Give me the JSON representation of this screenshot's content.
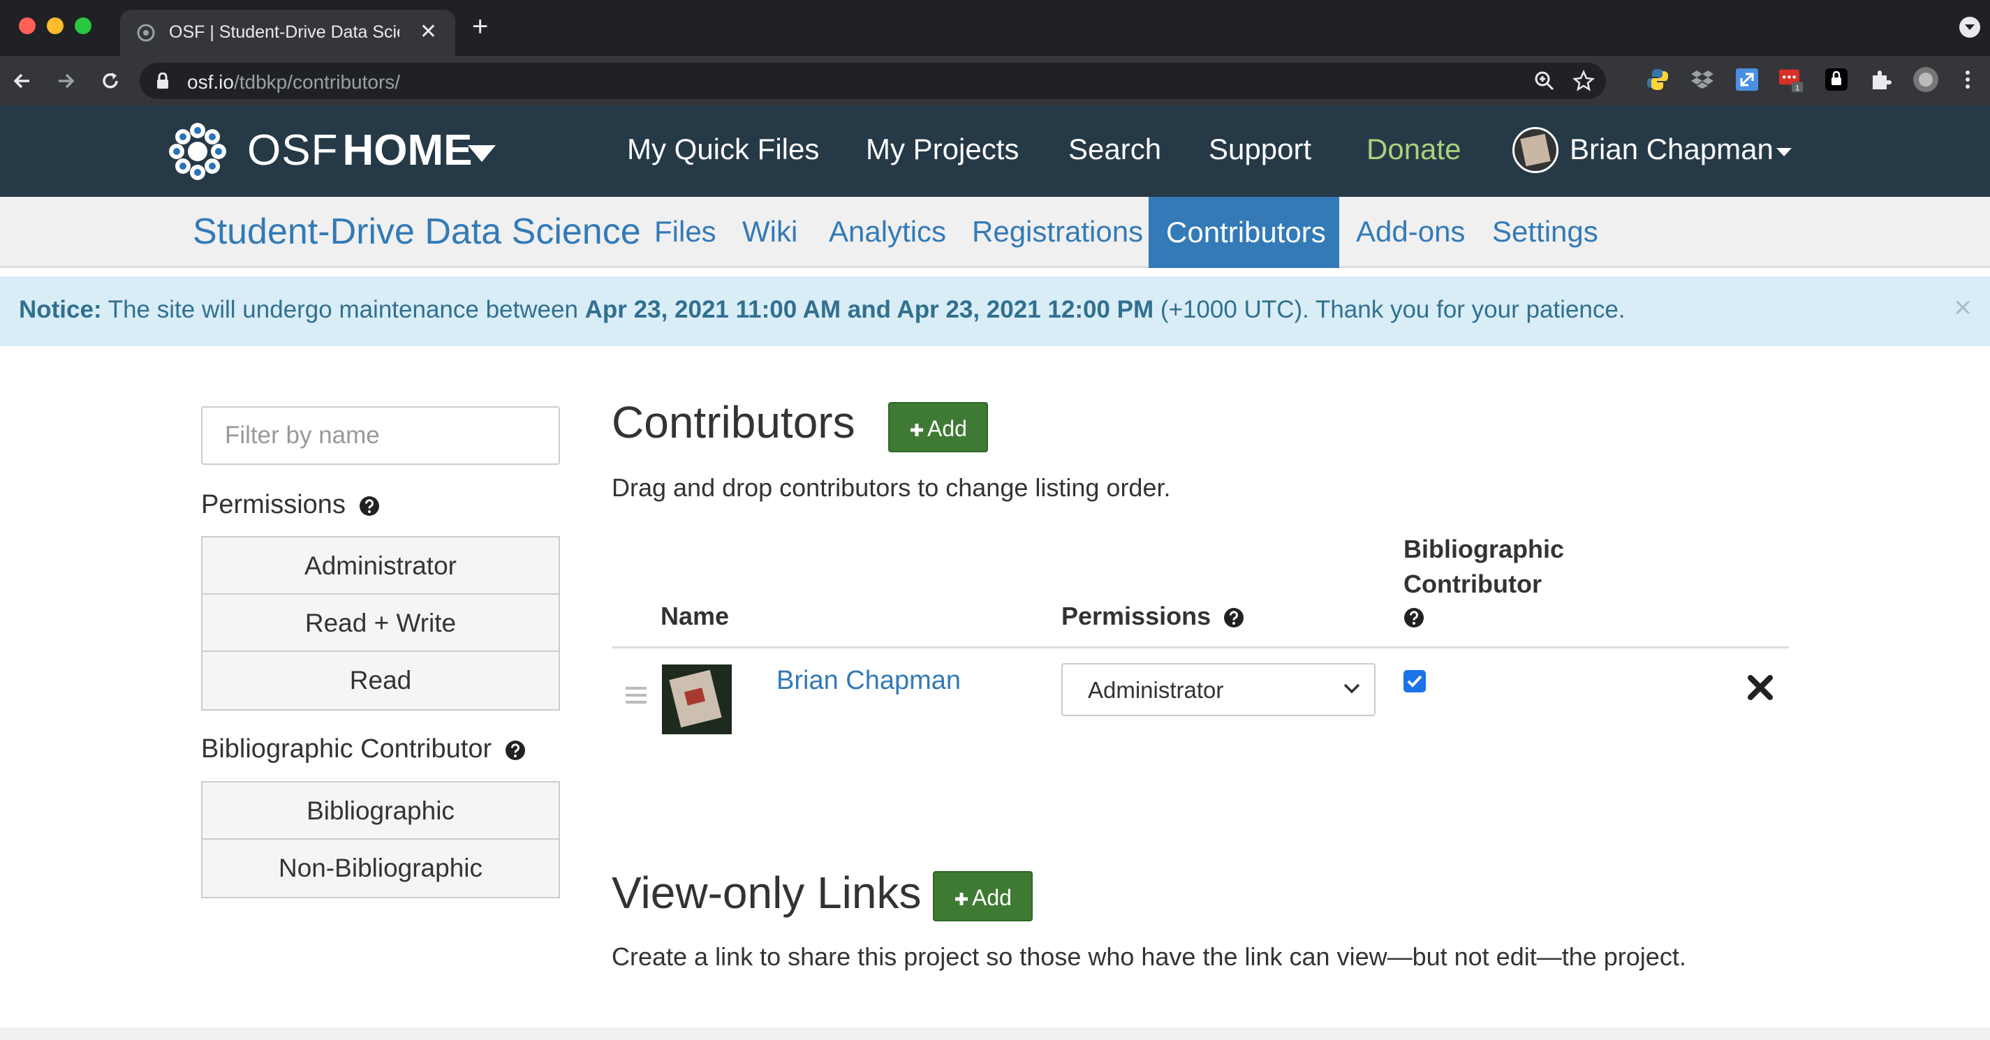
{
  "browser": {
    "tab_title": "OSF | Student-Drive Data Science",
    "url_host": "osf.io",
    "url_path": "/tdbkp/contributors/"
  },
  "osf_nav": {
    "brand_osf": "OSF",
    "brand_home": "HOME",
    "links": [
      "My Quick Files",
      "My Projects",
      "Search",
      "Support",
      "Donate"
    ],
    "user_name": "Brian Chapman",
    "donate_color": "#a8d37a",
    "bar_color": "#263947"
  },
  "project_nav": {
    "title": "Student-Drive Data Science",
    "tabs": [
      "Files",
      "Wiki",
      "Analytics",
      "Registrations",
      "Contributors",
      "Add-ons",
      "Settings"
    ],
    "active_tab": "Contributors",
    "accent": "#337ab7"
  },
  "notice": {
    "label": "Notice:",
    "text_1": " The site will undergo maintenance between ",
    "dates": "Apr 23, 2021 11:00 AM and Apr 23, 2021 12:00 PM",
    "text_2": " (+1000 UTC). Thank you for your patience.",
    "close": "×"
  },
  "filters": {
    "placeholder": "Filter by name",
    "permissions_label": "Permissions",
    "permissions": [
      "Administrator",
      "Read + Write",
      "Read"
    ],
    "bibliographic_label": "Bibliographic Contributor",
    "bibliographic": [
      "Bibliographic",
      "Non-Bibliographic"
    ]
  },
  "contributors": {
    "heading": "Contributors",
    "add_label": "Add",
    "description": "Drag and drop contributors to change listing order.",
    "columns": {
      "name": "Name",
      "permissions": "Permissions",
      "bib_line1": "Bibliographic",
      "bib_line2": "Contributor"
    },
    "rows": [
      {
        "name": "Brian Chapman",
        "permission": "Administrator",
        "bibliographic": true
      }
    ]
  },
  "view_only": {
    "heading": "View-only Links",
    "add_label": "Add",
    "description": "Create a link to share this project so those who have the link can view—but not edit—the project."
  },
  "icons": {
    "help": "question-circle-icon",
    "remove": "remove-x-icon",
    "drag": "drag-handle-icon",
    "plus": "plus-icon"
  },
  "colors": {
    "add_button": "#3e7a33",
    "notice_bg": "#d9edf7",
    "notice_text": "#31708f"
  }
}
